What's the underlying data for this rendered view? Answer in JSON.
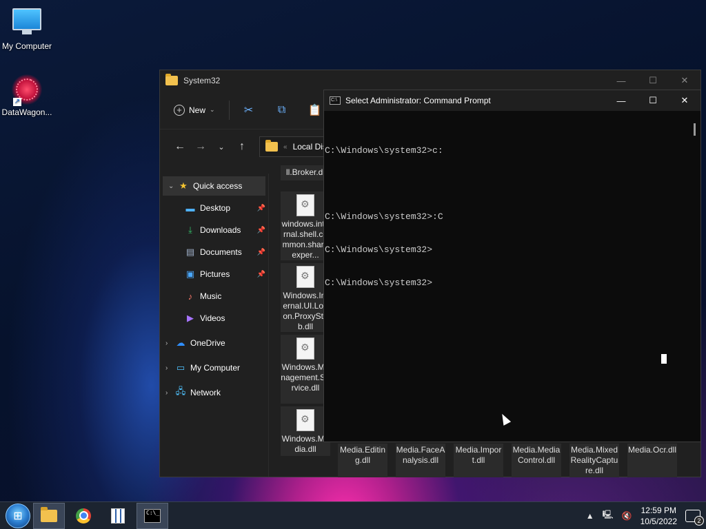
{
  "desktop": {
    "icons": [
      {
        "label": "My Computer"
      },
      {
        "label": "DataWagon..."
      }
    ]
  },
  "explorer": {
    "title": "System32",
    "toolbar": {
      "new_label": "New"
    },
    "address": {
      "path_short": "Local Disk"
    },
    "nav": [
      {
        "label": "Quick access"
      },
      {
        "label": "Desktop"
      },
      {
        "label": "Downloads"
      },
      {
        "label": "Documents"
      },
      {
        "label": "Pictures"
      },
      {
        "label": "Music"
      },
      {
        "label": "Videos"
      },
      {
        "label": "OneDrive"
      },
      {
        "label": "My Computer"
      },
      {
        "label": "Network"
      }
    ],
    "files_col": [
      {
        "name": "ll.Broker.dl"
      },
      {
        "name": "windows.internal.shell.common.shareexper..."
      },
      {
        "name": "Windows.Internal.UI.Logon.ProxyStub.dll"
      },
      {
        "name": "Windows.Management.Service.dll"
      },
      {
        "name": "Windows.Media.dll"
      }
    ],
    "files_row": [
      {
        "name": "Media.Editing.dll"
      },
      {
        "name": "Media.FaceAnalysis.dll"
      },
      {
        "name": "Media.Import.dll"
      },
      {
        "name": "Media.MediaControl.dll"
      },
      {
        "name": "Media.MixedRealityCapture.dll"
      },
      {
        "name": "Media.Ocr.dll"
      }
    ]
  },
  "cmd": {
    "title": "Select Administrator: Command Prompt",
    "lines": [
      "C:\\Windows\\system32>c:",
      "",
      "C:\\Windows\\system32>:C",
      "C:\\Windows\\system32>",
      "C:\\Windows\\system32>"
    ]
  },
  "taskbar": {
    "time": "12:59 PM",
    "date": "10/5/2022",
    "notification_count": "2"
  }
}
